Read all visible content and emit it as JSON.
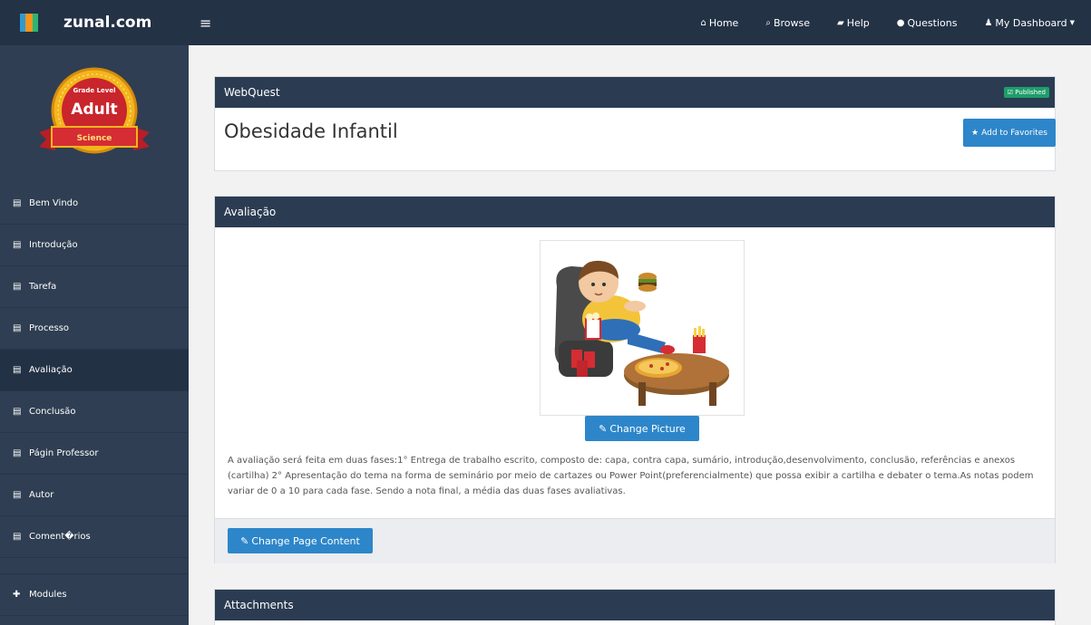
{
  "brand": {
    "name": "zunal.com",
    "logo_colors": [
      "#2e9ad0",
      "#f7941d",
      "#2bb673"
    ],
    "accent": "#2d86c9",
    "topbar_bg": "#243246",
    "sidebar_bg": "#2f3e52"
  },
  "topnav": {
    "menu_icon": "hamburger-icon",
    "items": [
      {
        "icon": "home-icon",
        "glyph": "⌂",
        "label": "Home"
      },
      {
        "icon": "search-icon",
        "glyph": "⌕",
        "label": "Browse"
      },
      {
        "icon": "book-icon",
        "glyph": "▰",
        "label": "Help"
      },
      {
        "icon": "comments-icon",
        "glyph": "●",
        "label": "Questions"
      },
      {
        "icon": "user-icon",
        "glyph": "♟",
        "label": "My Dashboard"
      }
    ]
  },
  "grade_badge": {
    "top": "Grade Level",
    "level": "Adult",
    "subject": "Science"
  },
  "sidebar": {
    "items": [
      {
        "label": "Bem Vindo",
        "active": false
      },
      {
        "label": "Introdução",
        "active": false
      },
      {
        "label": "Tarefa",
        "active": false
      },
      {
        "label": "Processo",
        "active": false
      },
      {
        "label": "Avaliação",
        "active": true
      },
      {
        "label": "Conclusão",
        "active": false
      },
      {
        "label": "Págin Professor",
        "active": false
      },
      {
        "label": "Autor",
        "active": false
      },
      {
        "label": "Coment�rios",
        "active": false
      }
    ],
    "modules_label": "Modules"
  },
  "webquest": {
    "header": "WebQuest",
    "status": "Published",
    "title": "Obesidade Infantil",
    "favorite_button": "Add to Favorites"
  },
  "section": {
    "header": "Avaliação",
    "change_picture": "Change Picture",
    "text": "A avaliação será feita em duas fases:1° Entrega de trabalho escrito, composto de: capa, contra capa, sumário, introdução,desenvolvimento, conclusão, referências e anexos (cartilha) 2° Apresentação do tema na forma de seminário por meio de cartazes ou Power Point(preferencialmente) que possa exibir a cartilha e debater o tema.As notas podem variar de 0 a 10 para cada fase. Sendo a nota final, a média das duas fases avaliativas.",
    "change_content": "Change Page Content"
  },
  "attachments": {
    "header": "Attachments"
  }
}
